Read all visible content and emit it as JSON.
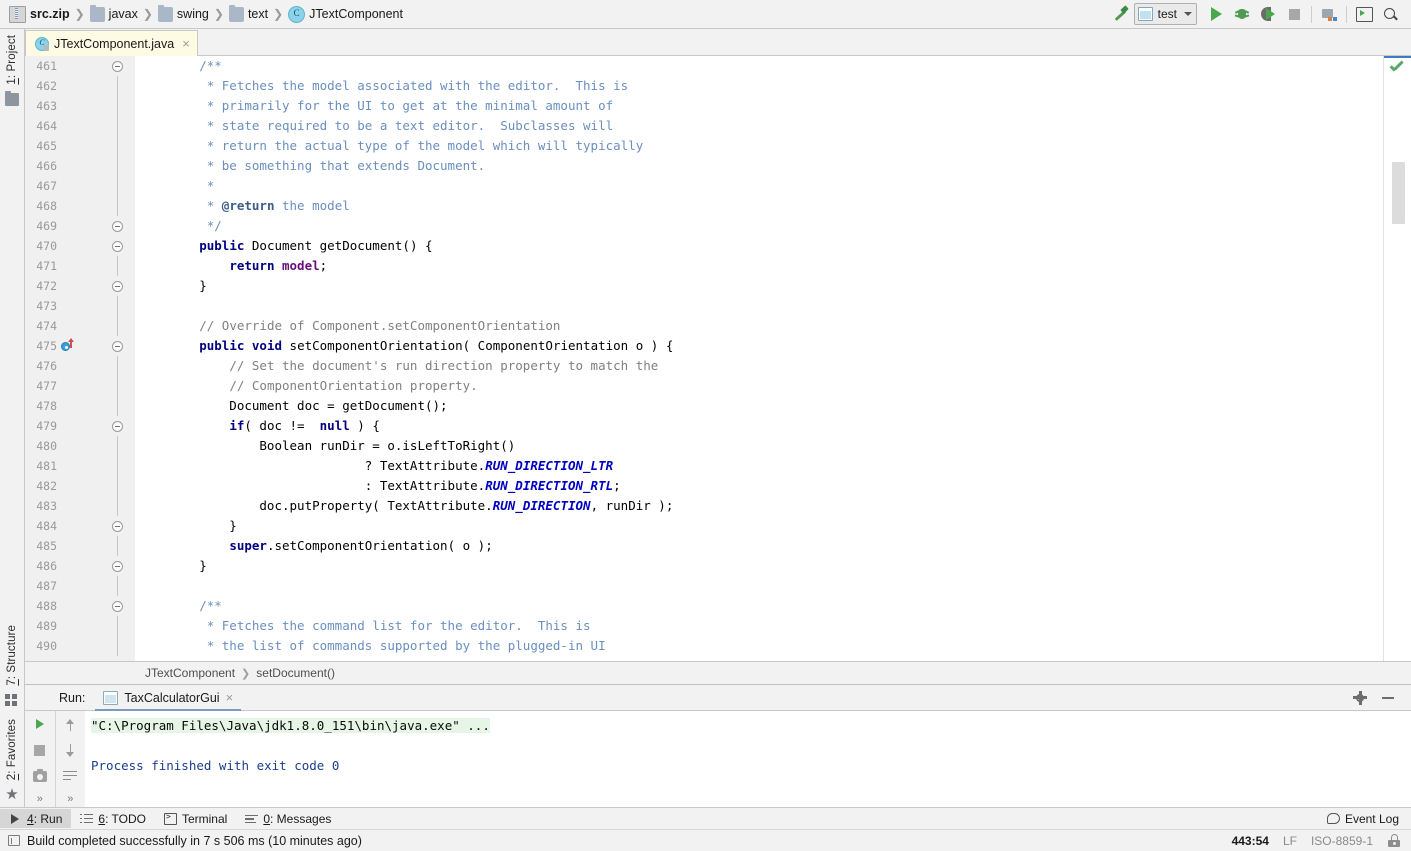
{
  "breadcrumb": {
    "items": [
      {
        "label": "src.zip",
        "icon": "zip-icon",
        "bold": true
      },
      {
        "label": "javax",
        "icon": "folder-icon",
        "bold": false
      },
      {
        "label": "swing",
        "icon": "folder-icon",
        "bold": false
      },
      {
        "label": "text",
        "icon": "folder-icon",
        "bold": false
      },
      {
        "label": "JTextComponent",
        "icon": "class-icon",
        "bold": false
      }
    ]
  },
  "toolbar": {
    "build_icon": "hammer-icon",
    "run_config": "test",
    "run_icon": "run-icon",
    "debug_icon": "debug-icon",
    "coverage_icon": "coverage-icon",
    "stop_icon": "stop-icon",
    "project_structure_icon": "project-structure-icon",
    "window_icon": "window-icon",
    "search_icon": "search-icon"
  },
  "left_rail": {
    "top": [
      {
        "label": "1: Project",
        "number": "1",
        "rest": ": Project",
        "icon": "folder-icon"
      }
    ],
    "bottom": [
      {
        "label": "7: Structure",
        "number": "7",
        "rest": ": Structure",
        "icon": "structure-icon"
      },
      {
        "label": "2: Favorites",
        "number": "2",
        "rest": ": Favorites",
        "icon": "star-icon"
      }
    ]
  },
  "editor": {
    "tab": {
      "name": "JTextComponent.java",
      "icon": "java-class-locked-icon",
      "close": "×"
    },
    "first_line": 461,
    "lines": [
      {
        "n": 461,
        "fold": "start",
        "tokens": [
          {
            "t": "        ",
            "c": "pln"
          },
          {
            "t": "/**",
            "c": "doc"
          }
        ]
      },
      {
        "n": 462,
        "tokens": [
          {
            "t": "         * Fetches the model associated with the editor.  This is",
            "c": "doc"
          }
        ]
      },
      {
        "n": 463,
        "tokens": [
          {
            "t": "         * primarily for the UI to get at the minimal amount of",
            "c": "doc"
          }
        ]
      },
      {
        "n": 464,
        "tokens": [
          {
            "t": "         * state required to be a text editor.  Subclasses will",
            "c": "doc"
          }
        ]
      },
      {
        "n": 465,
        "tokens": [
          {
            "t": "         * return the actual type of the model which will typically",
            "c": "doc"
          }
        ]
      },
      {
        "n": 466,
        "tokens": [
          {
            "t": "         * be something that extends Document.",
            "c": "doc"
          }
        ]
      },
      {
        "n": 467,
        "tokens": [
          {
            "t": "         *",
            "c": "doc"
          }
        ]
      },
      {
        "n": 468,
        "tokens": [
          {
            "t": "         * ",
            "c": "doc"
          },
          {
            "t": "@return",
            "c": "doct"
          },
          {
            "t": " the model",
            "c": "doc"
          }
        ]
      },
      {
        "n": 469,
        "fold": "end",
        "tokens": [
          {
            "t": "         */",
            "c": "doc"
          }
        ]
      },
      {
        "n": 470,
        "fold": "start",
        "tokens": [
          {
            "t": "        ",
            "c": "pln"
          },
          {
            "t": "public",
            "c": "kw"
          },
          {
            "t": " Document getDocument() {",
            "c": "pln"
          }
        ]
      },
      {
        "n": 471,
        "tokens": [
          {
            "t": "            ",
            "c": "pln"
          },
          {
            "t": "return",
            "c": "kw"
          },
          {
            "t": " ",
            "c": "pln"
          },
          {
            "t": "model",
            "c": "fld"
          },
          {
            "t": ";",
            "c": "pln"
          }
        ]
      },
      {
        "n": 472,
        "fold": "end",
        "tokens": [
          {
            "t": "        }",
            "c": "pln"
          }
        ]
      },
      {
        "n": 473,
        "tokens": []
      },
      {
        "n": 474,
        "tokens": [
          {
            "t": "        ",
            "c": "pln"
          },
          {
            "t": "// Override of Component.setComponentOrientation",
            "c": "cmt"
          }
        ]
      },
      {
        "n": 475,
        "fold": "start",
        "marker": "override-icon",
        "tokens": [
          {
            "t": "        ",
            "c": "pln"
          },
          {
            "t": "public",
            "c": "kw"
          },
          {
            "t": " ",
            "c": "pln"
          },
          {
            "t": "void",
            "c": "kw"
          },
          {
            "t": " setComponentOrientation( ComponentOrientation o ) {",
            "c": "pln"
          }
        ]
      },
      {
        "n": 476,
        "tokens": [
          {
            "t": "            ",
            "c": "pln"
          },
          {
            "t": "// Set the document's run direction property to match the",
            "c": "cmt"
          }
        ]
      },
      {
        "n": 477,
        "tokens": [
          {
            "t": "            ",
            "c": "pln"
          },
          {
            "t": "// ComponentOrientation property.",
            "c": "cmt"
          }
        ]
      },
      {
        "n": 478,
        "tokens": [
          {
            "t": "            Document doc = getDocument();",
            "c": "pln"
          }
        ]
      },
      {
        "n": 479,
        "fold": "start",
        "tokens": [
          {
            "t": "            ",
            "c": "pln"
          },
          {
            "t": "if",
            "c": "kw"
          },
          {
            "t": "( doc !=  ",
            "c": "pln"
          },
          {
            "t": "null",
            "c": "kw"
          },
          {
            "t": " ) {",
            "c": "pln"
          }
        ]
      },
      {
        "n": 480,
        "tokens": [
          {
            "t": "                Boolean runDir = o.isLeftToRight()",
            "c": "pln"
          }
        ]
      },
      {
        "n": 481,
        "tokens": [
          {
            "t": "                              ? TextAttribute.",
            "c": "pln"
          },
          {
            "t": "RUN_DIRECTION_LTR",
            "c": "sfld"
          }
        ]
      },
      {
        "n": 482,
        "tokens": [
          {
            "t": "                              : TextAttribute.",
            "c": "pln"
          },
          {
            "t": "RUN_DIRECTION_RTL",
            "c": "sfld"
          },
          {
            "t": ";",
            "c": "pln"
          }
        ]
      },
      {
        "n": 483,
        "tokens": [
          {
            "t": "                doc.putProperty( TextAttribute.",
            "c": "pln"
          },
          {
            "t": "RUN_DIRECTION",
            "c": "sfld"
          },
          {
            "t": ", runDir );",
            "c": "pln"
          }
        ]
      },
      {
        "n": 484,
        "fold": "end",
        "tokens": [
          {
            "t": "            }",
            "c": "pln"
          }
        ]
      },
      {
        "n": 485,
        "tokens": [
          {
            "t": "            ",
            "c": "pln"
          },
          {
            "t": "super",
            "c": "kw"
          },
          {
            "t": ".setComponentOrientation( o );",
            "c": "pln"
          }
        ]
      },
      {
        "n": 486,
        "fold": "end",
        "tokens": [
          {
            "t": "        }",
            "c": "pln"
          }
        ]
      },
      {
        "n": 487,
        "tokens": []
      },
      {
        "n": 488,
        "fold": "start",
        "tokens": [
          {
            "t": "        ",
            "c": "pln"
          },
          {
            "t": "/**",
            "c": "doc"
          }
        ]
      },
      {
        "n": 489,
        "tokens": [
          {
            "t": "         * Fetches the command list for the editor.  This is",
            "c": "doc"
          }
        ]
      },
      {
        "n": 490,
        "tokens": [
          {
            "t": "         * the list of commands supported by the plugged-in UI",
            "c": "doc"
          }
        ]
      }
    ],
    "inspection_status": "ok-check-icon",
    "breadcrumb_bottom": [
      "JTextComponent",
      "setDocument()"
    ]
  },
  "run_panel": {
    "label": "Run:",
    "tab": {
      "name": "TaxCalculatorGui",
      "close": "×"
    },
    "settings_icon": "gear-icon",
    "minimize_icon": "minimize-icon",
    "tools": [
      {
        "name": "rerun-icon"
      },
      {
        "name": "stop-icon"
      },
      {
        "name": "print-icon"
      },
      {
        "name": "expand-icon"
      },
      {
        "name": "up-icon"
      },
      {
        "name": "down-icon"
      },
      {
        "name": "soft-wrap-icon"
      },
      {
        "name": "expand-icon"
      }
    ],
    "console": [
      {
        "text": "\"C:\\Program Files\\Java\\jdk1.8.0_151\\bin\\java.exe\" ...",
        "style": "cmd"
      },
      {
        "text": "",
        "style": "plain"
      },
      {
        "text": "Process finished with exit code 0",
        "style": "exit"
      }
    ]
  },
  "tool_windows": [
    {
      "number": "4",
      "rest": ": Run",
      "icon": "run-icon",
      "active": true
    },
    {
      "number": "6",
      "rest": ": TODO",
      "icon": "todo-icon",
      "active": false
    },
    {
      "number": "",
      "rest": "Terminal",
      "icon": "terminal-icon",
      "active": false
    },
    {
      "number": "0",
      "rest": ": Messages",
      "icon": "messages-icon",
      "active": false
    }
  ],
  "event_log": {
    "label": "Event Log",
    "icon": "bubble-icon"
  },
  "status_bar": {
    "message": "Build completed successfully in 7 s 506 ms (10 minutes ago)",
    "icon": "build-icon",
    "position": "443:54",
    "line_separator": "LF",
    "encoding": "ISO-8859-1",
    "lock_icon": "lock-icon"
  },
  "colors": {
    "chrome": "#f2f2f2",
    "editor_bg": "#ffffff",
    "gutter_bg": "#f0f0f0",
    "tab_active": "#fdfbe4",
    "keyword": "#000080",
    "javadoc": "#6a8fbf",
    "comment": "#808080",
    "field": "#660e7a",
    "static_field": "#0000c0",
    "accent_green": "#49a84c",
    "console_highlight": "#e6f5e6"
  }
}
